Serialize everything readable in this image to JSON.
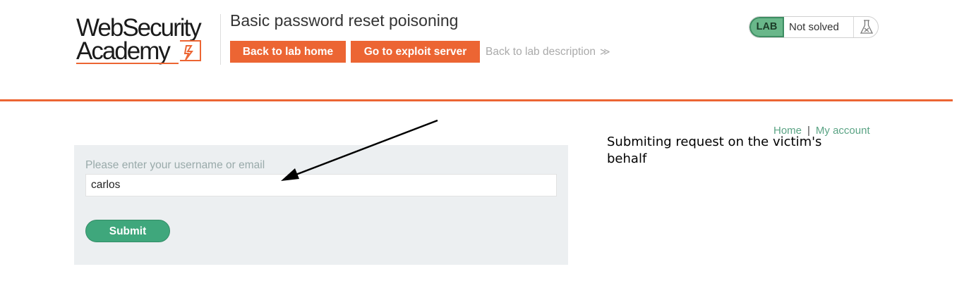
{
  "logo": {
    "line1": "WebSecurity",
    "line2": "Academy"
  },
  "lab": {
    "title": "Basic password reset poisoning",
    "back_home_label": "Back to lab home",
    "exploit_label": "Go to exploit server",
    "description_label": "Back to lab description",
    "description_chevron": "≫"
  },
  "status": {
    "badge": "LAB",
    "text": "Not solved",
    "icon": "flask-icon"
  },
  "nav": {
    "home": "Home",
    "separator": "|",
    "account": "My account"
  },
  "annotation": "Submiting request on the victim's behalf",
  "form": {
    "label": "Please enter your username or email",
    "value": "carlos",
    "submit_label": "Submit"
  },
  "colors": {
    "accent": "#ec6533",
    "success": "#3fa77c",
    "link": "#5aa384",
    "panel": "#eceff1"
  }
}
